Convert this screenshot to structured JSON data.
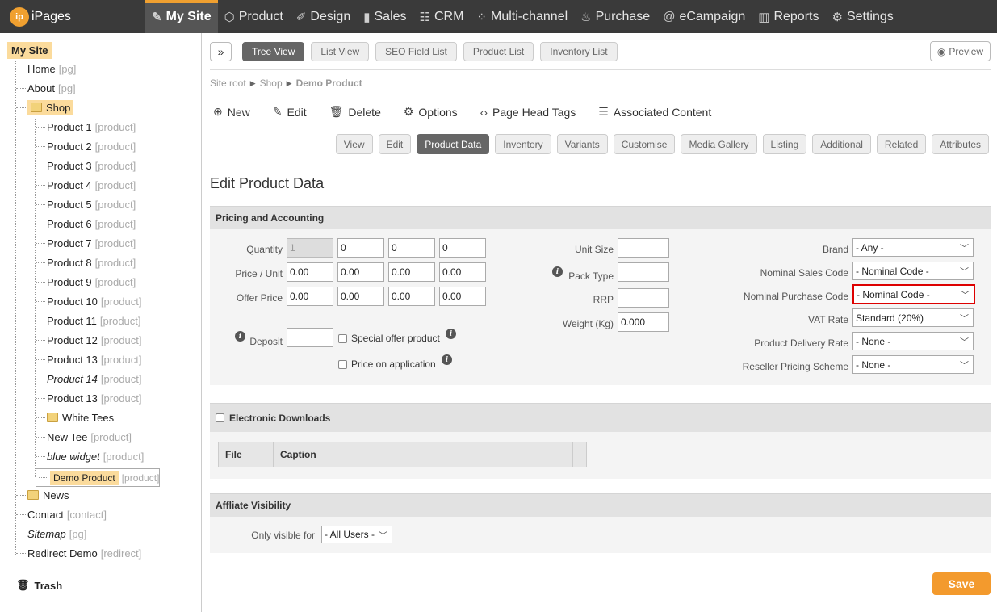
{
  "brand": {
    "badge": "ip",
    "name": "iPages",
    "accent": "#f0a030"
  },
  "nav": [
    {
      "label": "My Site",
      "icon": "page-edit-icon",
      "glyph": "✎",
      "active": true
    },
    {
      "label": "Product",
      "icon": "box-icon",
      "glyph": "⬡"
    },
    {
      "label": "Design",
      "icon": "design-icon",
      "glyph": "✐"
    },
    {
      "label": "Sales",
      "icon": "sales-icon",
      "glyph": "▮"
    },
    {
      "label": "CRM",
      "icon": "contacts-icon",
      "glyph": "☷"
    },
    {
      "label": "Multi-channel",
      "icon": "network-icon",
      "glyph": "⁘"
    },
    {
      "label": "Purchase",
      "icon": "handshake-icon",
      "glyph": "♨"
    },
    {
      "label": "eCampaign",
      "icon": "at-icon",
      "glyph": "@"
    },
    {
      "label": "Reports",
      "icon": "chart-icon",
      "glyph": "▥"
    },
    {
      "label": "Settings",
      "icon": "gear-icon",
      "glyph": "⚙"
    }
  ],
  "tree": {
    "root": "My Site",
    "items": [
      {
        "label": "Home",
        "tag": "[pg]"
      },
      {
        "label": "About",
        "tag": "[pg]"
      },
      {
        "label": "Shop",
        "tag": ""
      },
      {
        "label": "Product 1",
        "tag": "[product]"
      },
      {
        "label": "Product 2",
        "tag": "[product]"
      },
      {
        "label": "Product 3",
        "tag": "[product]"
      },
      {
        "label": "Product 4",
        "tag": "[product]"
      },
      {
        "label": "Product 5",
        "tag": "[product]"
      },
      {
        "label": "Product 6",
        "tag": "[product]"
      },
      {
        "label": "Product 7",
        "tag": "[product]"
      },
      {
        "label": "Product 8",
        "tag": "[product]"
      },
      {
        "label": "Product 9",
        "tag": "[product]"
      },
      {
        "label": "Product 10",
        "tag": "[product]"
      },
      {
        "label": "Product 11",
        "tag": "[product]"
      },
      {
        "label": "Product 12",
        "tag": "[product]"
      },
      {
        "label": "Product 13",
        "tag": "[product]"
      },
      {
        "label": "Product 14",
        "tag": "[product]"
      },
      {
        "label": "Product 13",
        "tag": "[product]"
      },
      {
        "label": "White Tees",
        "tag": ""
      },
      {
        "label": "New Tee",
        "tag": "[product]"
      },
      {
        "label": "blue widget",
        "tag": "[product]"
      },
      {
        "label": "Demo Product",
        "tag": "[product]"
      },
      {
        "label": "News",
        "tag": ""
      },
      {
        "label": "Contact",
        "tag": "[contact]"
      },
      {
        "label": "Sitemap",
        "tag": "[pg]"
      },
      {
        "label": "Redirect Demo",
        "tag": "[redirect]"
      }
    ],
    "trash": "Trash"
  },
  "view_tabs": [
    "Tree View",
    "List View",
    "SEO Field List",
    "Product List",
    "Inventory List"
  ],
  "preview": "Preview",
  "breadcrumb": [
    "Site root",
    "Shop",
    "Demo Product"
  ],
  "actions": [
    {
      "label": "New",
      "icon": "plus-circle-icon",
      "glyph": "⊕"
    },
    {
      "label": "Edit",
      "icon": "pencil-icon",
      "glyph": "✎"
    },
    {
      "label": "Delete",
      "icon": "trash-icon",
      "glyph": "🗑"
    },
    {
      "label": "Options",
      "icon": "gear-icon",
      "glyph": "⚙"
    },
    {
      "label": "Page Head Tags",
      "icon": "code-icon",
      "glyph": "‹›"
    },
    {
      "label": "Associated Content",
      "icon": "list-icon",
      "glyph": "☰"
    }
  ],
  "sub_tabs": [
    "View",
    "Edit",
    "Product Data",
    "Inventory",
    "Variants",
    "Customise",
    "Media Gallery",
    "Listing",
    "Additional",
    "Related",
    "Attributes"
  ],
  "page_title": "Edit Product Data",
  "pricing": {
    "title": "Pricing and Accounting",
    "quantity_label": "Quantity",
    "quantity": [
      "1",
      "0",
      "0",
      "0"
    ],
    "price_label": "Price / Unit",
    "price": [
      "0.00",
      "0.00",
      "0.00",
      "0.00"
    ],
    "offer_label": "Offer Price",
    "offer": [
      "0.00",
      "0.00",
      "0.00",
      "0.00"
    ],
    "deposit_label": "Deposit",
    "deposit": "",
    "special_offer": "Special offer product",
    "price_on_app": "Price on application",
    "unit_size_label": "Unit Size",
    "pack_type_label": "Pack Type",
    "rrp_label": "RRP",
    "weight_label": "Weight (Kg)",
    "weight": "0.000",
    "brand_label": "Brand",
    "brand": "- Any -",
    "nom_sales_label": "Nominal Sales Code",
    "nom_sales": "- Nominal Code -",
    "nom_purchase_label": "Nominal Purchase Code",
    "nom_purchase": "- Nominal Code -",
    "vat_label": "VAT Rate",
    "vat": "Standard (20%)",
    "delivery_label": "Product Delivery Rate",
    "delivery": "- None -",
    "reseller_label": "Reseller Pricing Scheme",
    "reseller": "- None -"
  },
  "downloads": {
    "title": "Electronic Downloads",
    "cols": [
      "File",
      "Caption"
    ]
  },
  "affiliate": {
    "title": "Affliate Visibility",
    "label": "Only visible for",
    "value": "- All Users -"
  },
  "save": "Save"
}
